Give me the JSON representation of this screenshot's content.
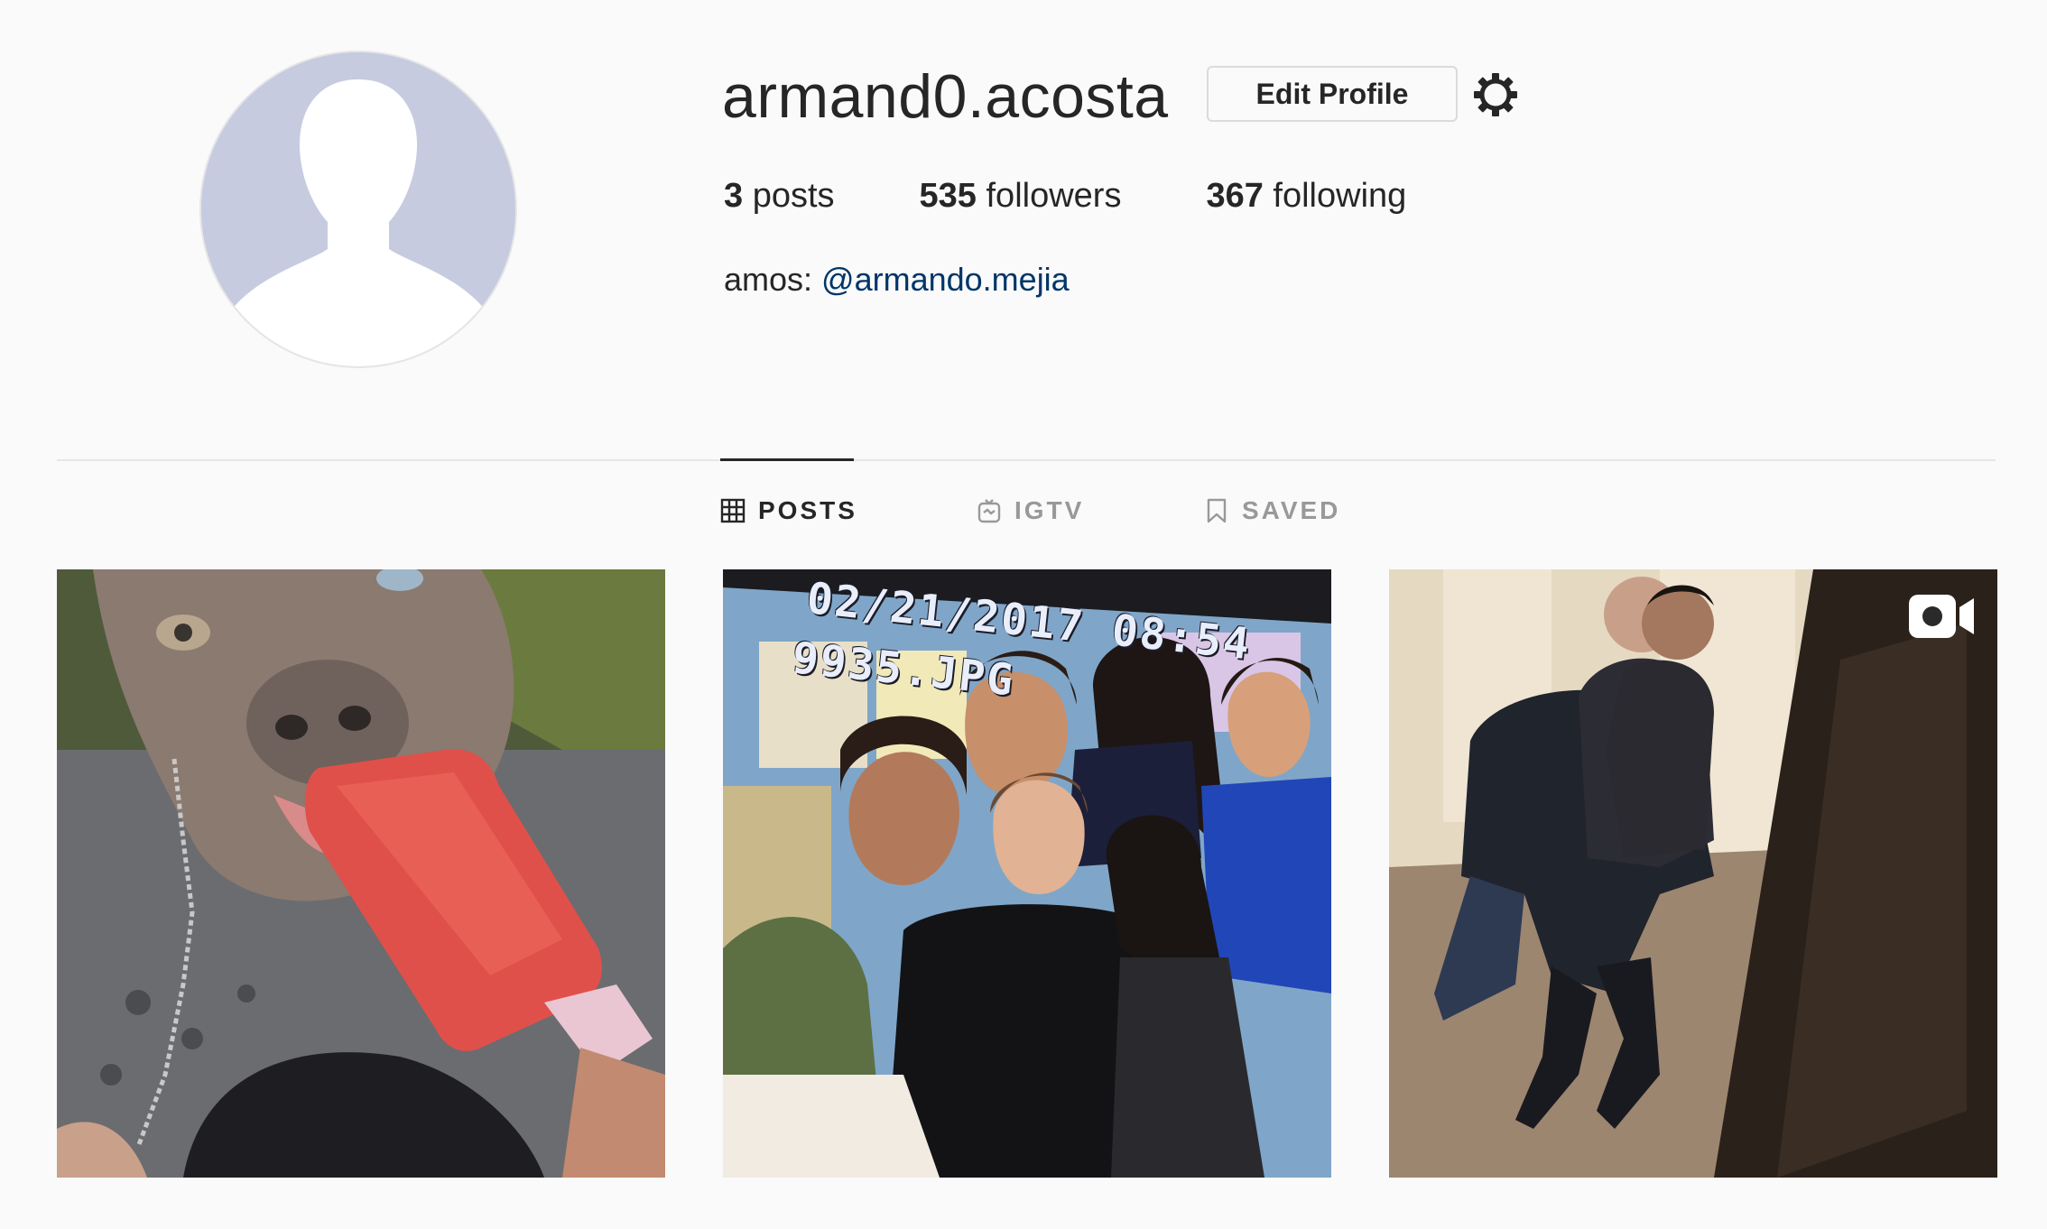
{
  "profile": {
    "username": "armand0.acosta",
    "edit_label": "Edit Profile",
    "settings_icon": "gear-icon",
    "avatar_icon": "default-avatar-silhouette",
    "stats": {
      "posts_count": "3",
      "posts_label": "posts",
      "followers_count": "535",
      "followers_label": "followers",
      "following_count": "367",
      "following_label": "following"
    },
    "bio": {
      "prefix": "amos: ",
      "mention": "@armando.mejia"
    }
  },
  "tabs": [
    {
      "label": "POSTS",
      "icon": "grid-icon",
      "active": true
    },
    {
      "label": "IGTV",
      "icon": "tv-icon",
      "active": false
    },
    {
      "label": "SAVED",
      "icon": "bookmark-icon",
      "active": false
    }
  ],
  "posts": [
    {
      "subject": "dog-licking-red-popsicle",
      "type": "photo"
    },
    {
      "subject": "group-of-students-classroom",
      "type": "photo",
      "stamp_line1": "02/21/2017 08:54",
      "stamp_line2": "9935.JPG"
    },
    {
      "subject": "kids-in-hallway",
      "type": "video",
      "badge_icon": "video-camera-icon"
    }
  ],
  "colors": {
    "background": "#fafafa",
    "text": "#262626",
    "link": "#003569",
    "muted": "#999999",
    "border": "#dbdbdb",
    "avatar": "#c7cbe0"
  }
}
